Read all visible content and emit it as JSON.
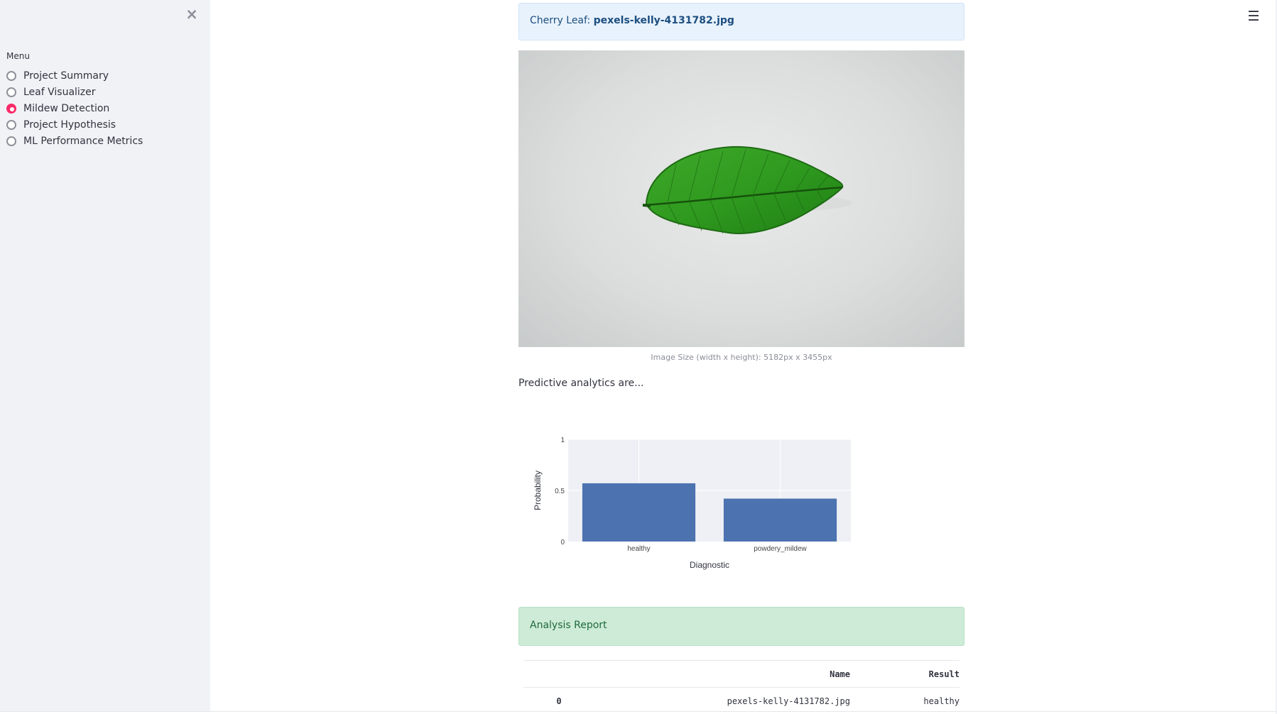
{
  "sidebar": {
    "close_symbol": "×",
    "menu_label": "Menu",
    "items": [
      {
        "label": "Project Summary",
        "selected": false
      },
      {
        "label": "Leaf Visualizer",
        "selected": false
      },
      {
        "label": "Mildew Detection",
        "selected": true
      },
      {
        "label": "Project Hypothesis",
        "selected": false
      },
      {
        "label": "ML Performance Metrics",
        "selected": false
      }
    ]
  },
  "header": {
    "hamburger_symbol": "☰"
  },
  "main": {
    "info_prefix": "Cherry Leaf: ",
    "info_filename": "pexels-kelly-4131782.jpg",
    "image_caption": "Image Size (width x height): 5182px x 3455px",
    "predictive_text": "Predictive analytics are...",
    "success_text": "Analysis Report"
  },
  "chart_data": {
    "type": "bar",
    "categories": [
      "healthy",
      "powdery_mildew"
    ],
    "values": [
      0.57,
      0.42
    ],
    "xlabel": "Diagnostic",
    "ylabel": "Probability",
    "ylim": [
      0,
      1
    ],
    "yticks": [
      0,
      0.5,
      1
    ],
    "ytick_labels": [
      "0",
      "0.5",
      "1"
    ],
    "grid": true,
    "bar_color": "#4c72b0",
    "plot_bg": "#eff0f5"
  },
  "table": {
    "headers": [
      "",
      "Name",
      "Result"
    ],
    "rows": [
      {
        "index": "0",
        "name": "pexels-kelly-4131782.jpg",
        "result": "healthy"
      }
    ]
  },
  "colors": {
    "accent": "#ff2b68",
    "sidebar_bg": "#f0f2f6",
    "info_bg": "#e8f2fc",
    "success_bg": "#cdebd7"
  }
}
